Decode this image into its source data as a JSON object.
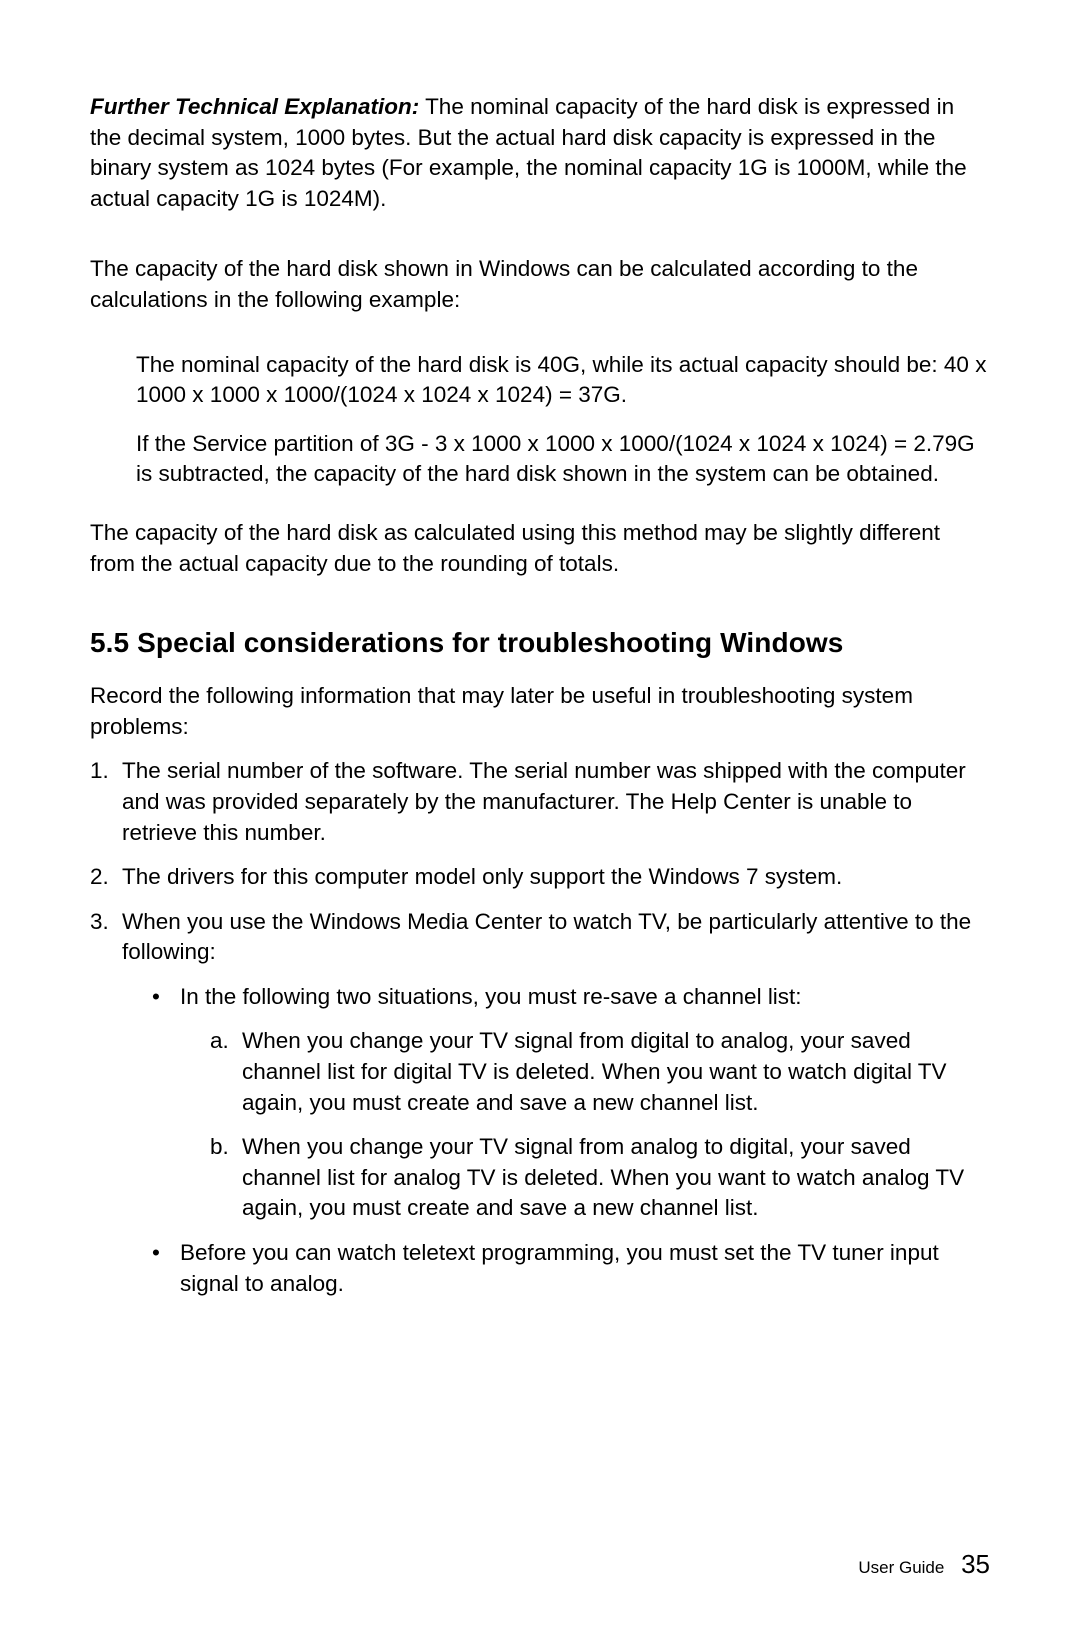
{
  "para1": {
    "label": "Further Technical Explanation:",
    "rest": " The nominal capacity of the hard disk is expressed in the decimal system, 1000 bytes. But the actual hard disk capacity is expressed in the binary system as 1024 bytes (For example, the nominal capacity 1G is 1000M, while the actual capacity 1G is 1024M)."
  },
  "para2": "The capacity of the hard disk shown in Windows can be calculated according to the calculations in the following example:",
  "indent": {
    "p1": "The nominal capacity of the hard disk is 40G, while its actual capacity should be: 40 x 1000 x 1000 x 1000/(1024 x 1024 x 1024) = 37G.",
    "p2": "If the Service partition of 3G - 3 x 1000 x 1000 x 1000/(1024 x 1024 x 1024) = 2.79G is subtracted, the capacity of the hard disk shown in the system can be obtained."
  },
  "para3": "The capacity of the hard disk as calculated using this method may be slightly different from the actual capacity due to the rounding of totals.",
  "heading": "5.5 Special considerations for troubleshooting Windows",
  "para4": "Record the following information that may later be useful in troubleshooting system problems:",
  "list": {
    "n1": {
      "marker": "1.",
      "text": "The serial number of the software. The serial number was shipped with the computer and was provided separately by the manufacturer. The Help Center is unable to retrieve this number."
    },
    "n2": {
      "marker": "2.",
      "text": "The drivers for this computer model only support the Windows 7 system."
    },
    "n3": {
      "marker": "3.",
      "text": "When you use the Windows Media Center to watch TV, be particularly attentive to the following:",
      "bullets": {
        "b1": {
          "dot": "•",
          "text": "In the following two situations, you must re-save a channel list:",
          "letters": {
            "a": {
              "marker": "a.",
              "text": "When you change your TV signal from digital to analog, your saved channel list for digital TV is deleted. When you want to watch digital TV again, you must create and save a new channel list."
            },
            "b": {
              "marker": "b.",
              "text": "When you change your TV signal from analog to digital, your saved channel list for analog TV is deleted. When you want to watch analog TV again, you must create and save a new channel list."
            }
          }
        },
        "b2": {
          "dot": "•",
          "text": "Before you can watch teletext programming, you must set the TV tuner input signal to analog."
        }
      }
    }
  },
  "footer": {
    "label": "User Guide",
    "page": "35"
  }
}
